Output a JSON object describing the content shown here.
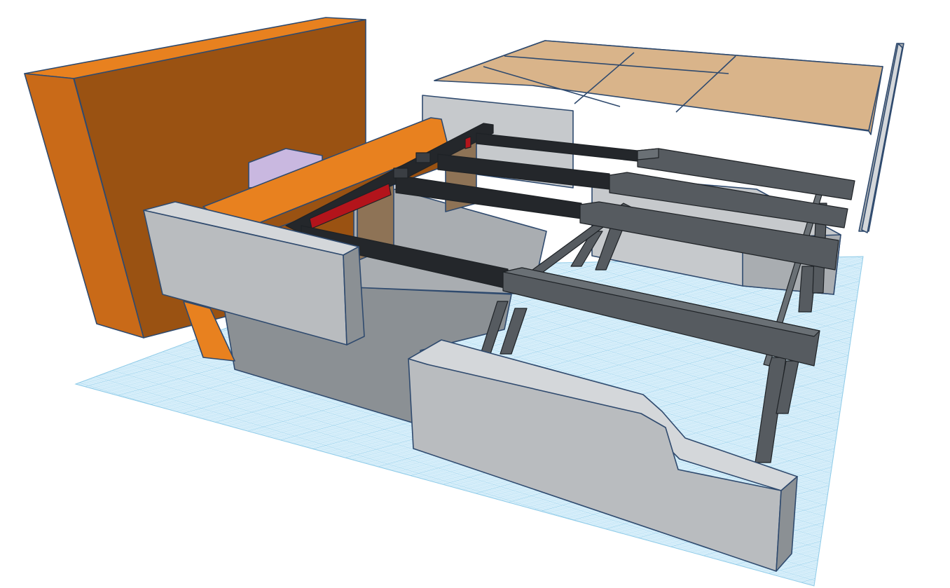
{
  "app": {
    "view": "3D workplane"
  },
  "colors": {
    "workplane_fill": "#d6eefa",
    "workplane_grid": "#9fd3ec",
    "workplane_grid_major": "#7cc2e4",
    "orange_front": "#e8811f",
    "orange_side": "#c96a18",
    "orange_back": "#9a5212",
    "gray_light": "#c6c9cc",
    "gray_mid": "#a9adb1",
    "gray_dark": "#8b9094",
    "frame_dark": "#24272b",
    "leg_gray": "#565b60",
    "accent_red": "#b3141b",
    "board_tan": "#d9b48a",
    "purple_block": "#c9b8e0",
    "wood_panel": "#8e7356"
  },
  "objects": [
    {
      "name": "orange-back-wall",
      "color": "orange"
    },
    {
      "name": "orange-shelf-board",
      "color": "orange"
    },
    {
      "name": "purple-block",
      "color": "purple"
    },
    {
      "name": "gray-end-panel-left",
      "color": "gray"
    },
    {
      "name": "gray-base-box",
      "color": "gray"
    },
    {
      "name": "gray-side-panel-front",
      "color": "gray"
    },
    {
      "name": "gray-back-panel",
      "color": "gray"
    },
    {
      "name": "tan-top-boards",
      "color": "tan"
    },
    {
      "name": "thin-panel-right",
      "color": "gray"
    },
    {
      "name": "black-frame",
      "color": "dark"
    },
    {
      "name": "gray-trestle-rack",
      "color": "gray"
    }
  ]
}
